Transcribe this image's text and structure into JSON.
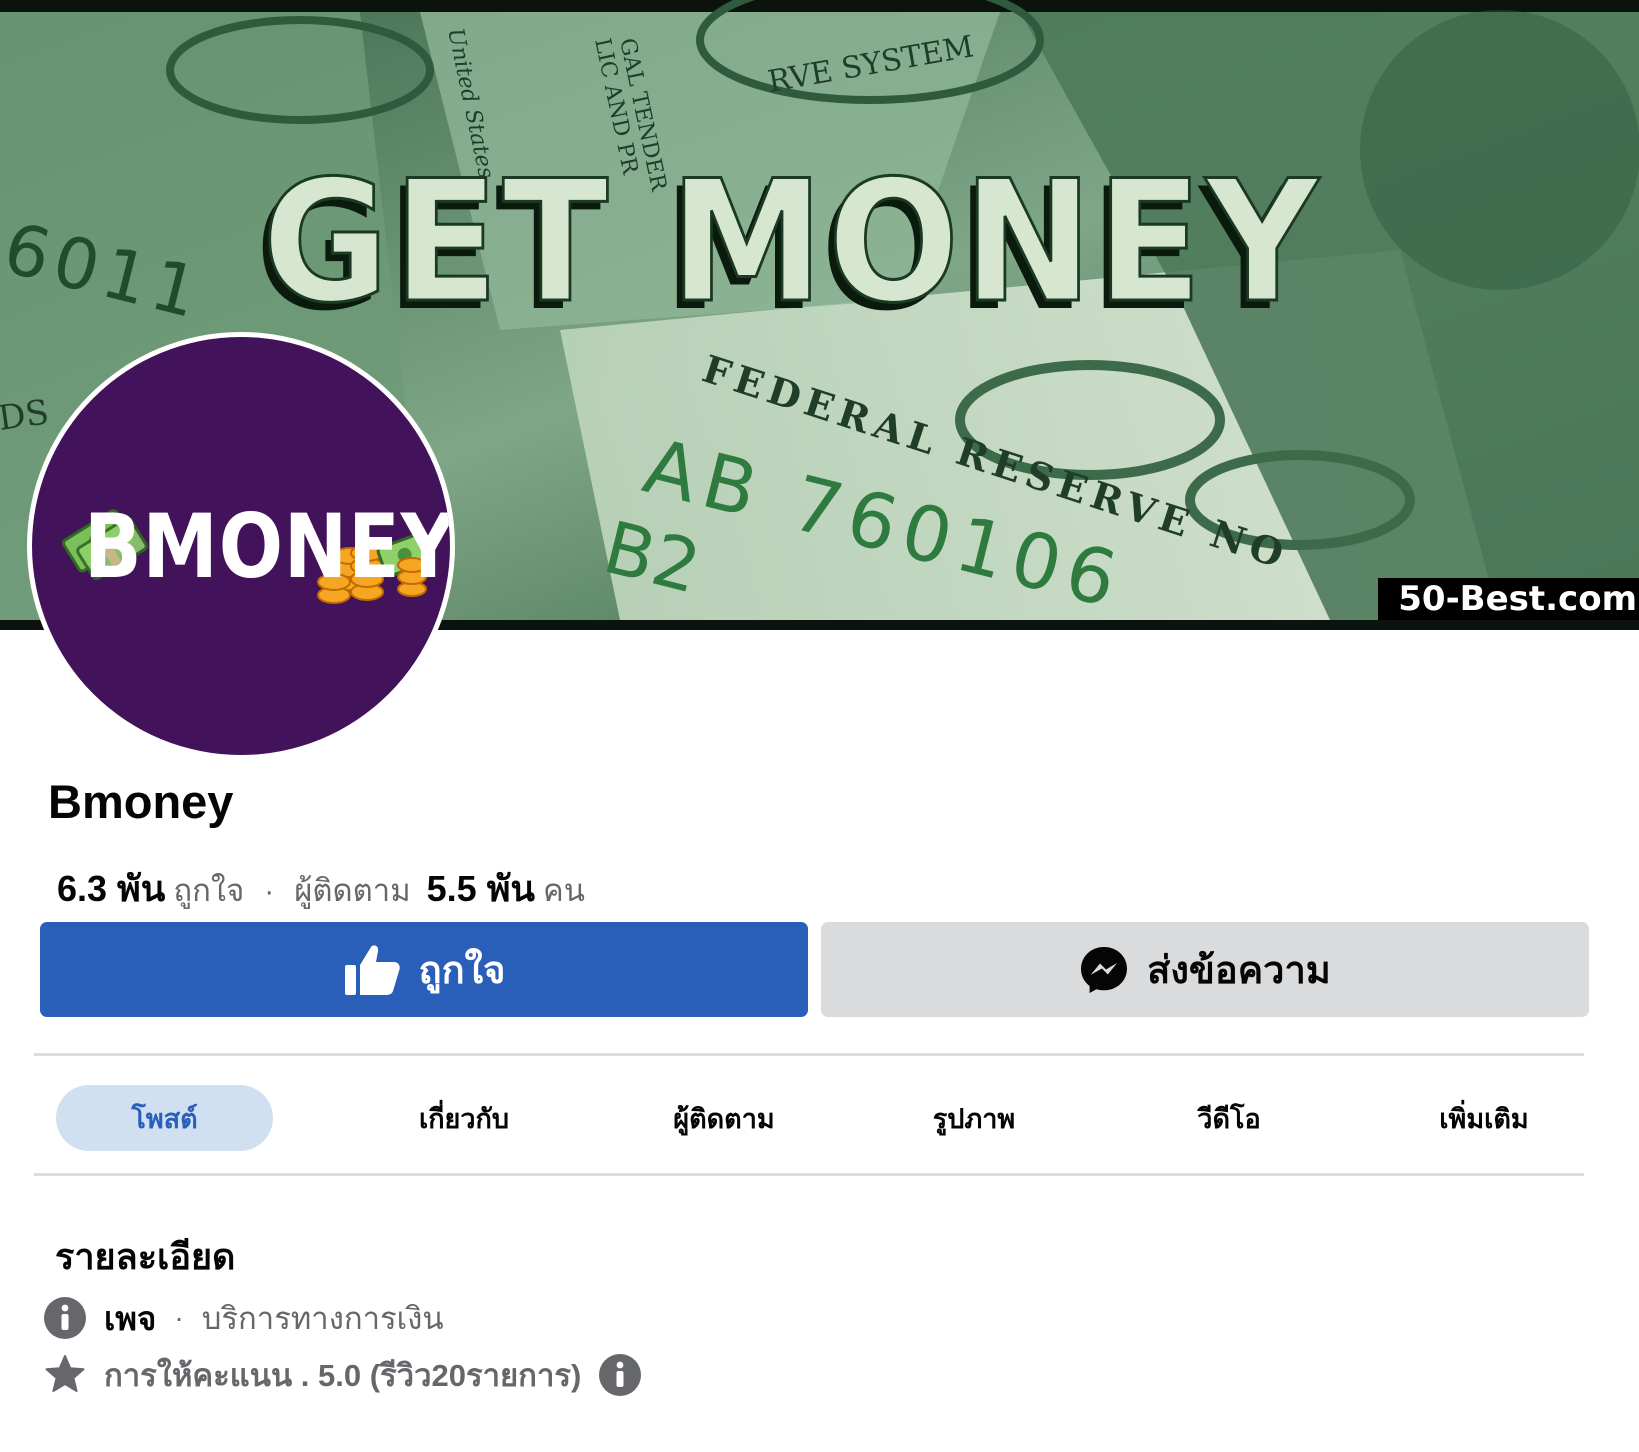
{
  "cover": {
    "headline": "GET MONEY",
    "bill_text_1": "FEDERAL RESERVE NO",
    "bill_text_2": "AB 760106",
    "bill_text_3": "B2",
    "bill_text_4": "RVE SYSTEM",
    "bill_text_5": "GAL TENDER",
    "bill_text_6": "LIC AND PR",
    "bill_text_7": "United States",
    "bill_text_8": "6011",
    "bill_text_9": "DS",
    "watermark": "50-Best.com"
  },
  "avatar": {
    "text": "BMONEY"
  },
  "page": {
    "name": "Bmoney",
    "likes_count": "6.3 พัน",
    "likes_label": "ถูกใจ",
    "separator": "·",
    "followers_label": "ผู้ติดตาม",
    "followers_count": "5.5 พัน",
    "followers_unit": "คน"
  },
  "actions": {
    "like_label": "ถูกใจ",
    "message_label": "ส่งข้อความ"
  },
  "tabs": [
    {
      "label": "โพสต์",
      "active": true
    },
    {
      "label": "เกี่ยวกับ"
    },
    {
      "label": "ผู้ติดตาม"
    },
    {
      "label": "รูปภาพ"
    },
    {
      "label": "วีดีโอ"
    },
    {
      "label": "เพิ่มเติม"
    }
  ],
  "details": {
    "heading": "รายละเอียด",
    "category": "เพจ",
    "separator": "·",
    "category_value": "บริการทางการเงิน",
    "rating_text": "การให้คะแนน . 5.0 (รีวิว20รายการ)"
  },
  "colors": {
    "primary": "#2a5fb9",
    "tab_active_bg": "#d0e0f1",
    "avatar_bg": "#42125a",
    "secondary_button": "#dadbdd",
    "muted_text": "#65676b"
  },
  "icons": {
    "like": "thumbs-up-icon",
    "message": "messenger-icon",
    "info": "info-icon",
    "rating": "star-icon"
  }
}
